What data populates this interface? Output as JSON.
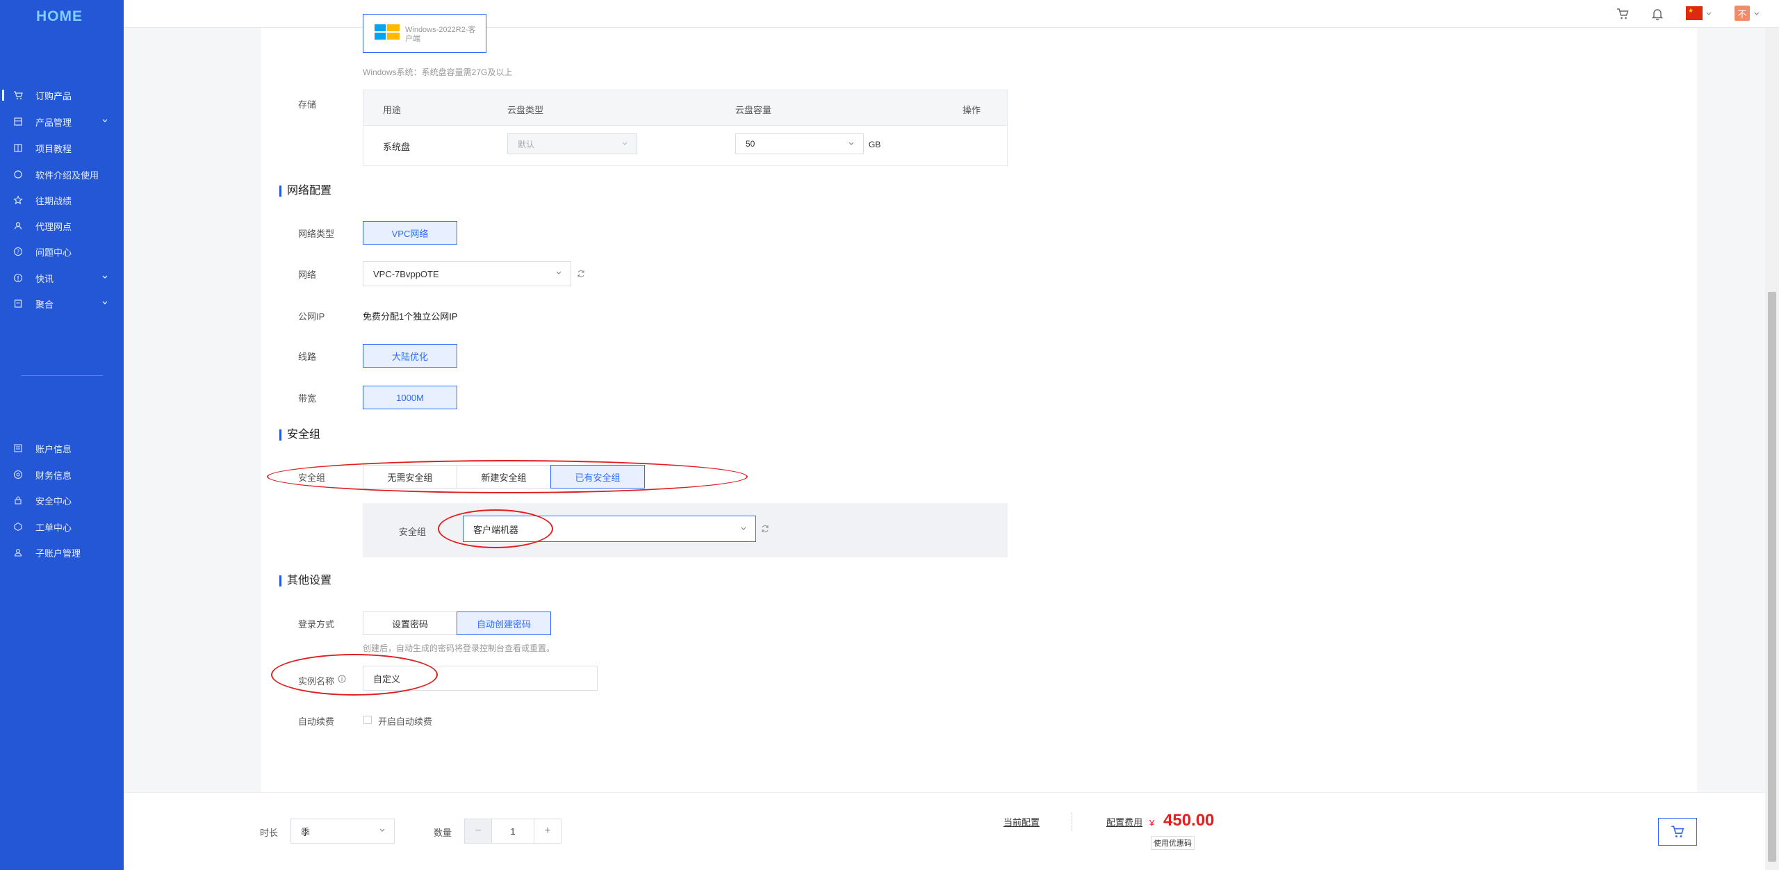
{
  "logo": "HOME",
  "sidebar": {
    "main": [
      {
        "label": "订购产品",
        "icon": "cart-icon",
        "active": true,
        "chevron": false
      },
      {
        "label": "产品管理",
        "icon": "box-icon",
        "active": false,
        "chevron": true
      },
      {
        "label": "项目教程",
        "icon": "book-icon",
        "active": false,
        "chevron": false
      },
      {
        "label": "软件介绍及使用",
        "icon": "circle-icon",
        "active": false,
        "chevron": false
      },
      {
        "label": "往期战绩",
        "icon": "star-icon",
        "active": false,
        "chevron": false
      },
      {
        "label": "代理网点",
        "icon": "users-icon",
        "active": false,
        "chevron": false
      },
      {
        "label": "问题中心",
        "icon": "question-icon",
        "active": false,
        "chevron": false
      },
      {
        "label": "快讯",
        "icon": "info-icon",
        "active": false,
        "chevron": true
      },
      {
        "label": "聚合",
        "icon": "bookmark-icon",
        "active": false,
        "chevron": true
      }
    ],
    "account": [
      {
        "label": "账户信息",
        "icon": "id-card-icon"
      },
      {
        "label": "财务信息",
        "icon": "wallet-icon"
      },
      {
        "label": "安全中心",
        "icon": "lock-icon"
      },
      {
        "label": "工单中心",
        "icon": "ticket-icon"
      },
      {
        "label": "子账户管理",
        "icon": "sub-user-icon"
      }
    ]
  },
  "topbar": {
    "avatar_text": "不"
  },
  "image": {
    "os_label": "Windows-2022R2-客户端",
    "os_hint": "Windows系统：系统盘容量需27G及以上"
  },
  "storage": {
    "label": "存储",
    "headers": [
      "用途",
      "云盘类型",
      "云盘容量",
      "操作"
    ],
    "row": {
      "usage": "系统盘",
      "type": "默认",
      "capacity": "50",
      "unit": "GB"
    }
  },
  "network": {
    "title": "网络配置",
    "type_label": "网络类型",
    "type_value": "VPC网络",
    "net_label": "网络",
    "net_value": "VPC-7BvppOTE",
    "ip_label": "公网IP",
    "ip_value": "免费分配1个独立公网IP",
    "line_label": "线路",
    "line_value": "大陆优化",
    "bw_label": "带宽",
    "bw_value": "1000M"
  },
  "security": {
    "title": "安全组",
    "label": "安全组",
    "options": [
      "无需安全组",
      "新建安全组",
      "已有安全组"
    ],
    "selected": 2,
    "sub_label": "安全组",
    "sub_value": "客户端机器"
  },
  "other": {
    "title": "其他设置",
    "login_label": "登录方式",
    "login_options": [
      "设置密码",
      "自动创建密码"
    ],
    "login_selected": 1,
    "login_hint": "创建后，自动生成的密码将登录控制台查看或重置。",
    "name_label": "实例名称",
    "name_value": "自定义",
    "renew_label": "自动续费",
    "renew_checkbox": "开启自动续费"
  },
  "footer": {
    "duration_label": "时长",
    "duration_value": "季",
    "qty_label": "数量",
    "qty_value": "1",
    "current_config": "当前配置",
    "config_fee": "配置费用",
    "currency": "¥",
    "price": "450.00",
    "coupon": "使用优惠码"
  },
  "colors": {
    "accent": "#2f6bff",
    "sidebar": "#2457d6",
    "annotation": "#e02020",
    "price": "#e02020"
  }
}
